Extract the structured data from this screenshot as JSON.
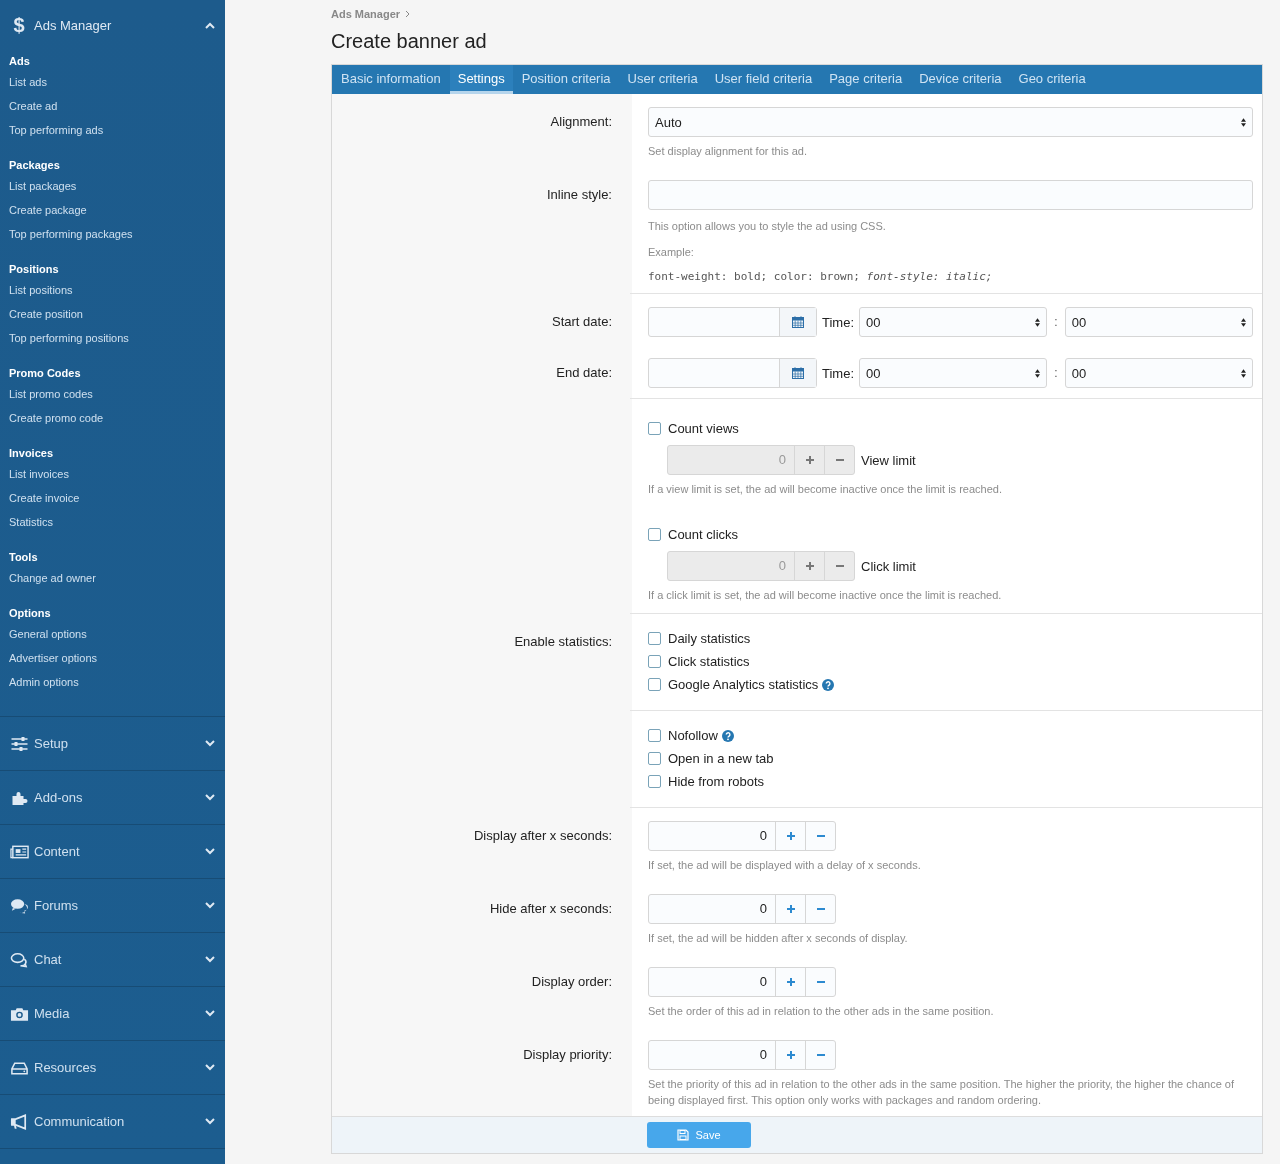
{
  "sidebar": {
    "header": {
      "symbol": "$",
      "title": "Ads Manager",
      "expanded": true
    },
    "groups": [
      {
        "title": "Ads",
        "links": [
          "List ads",
          "Create ad",
          "Top performing ads"
        ]
      },
      {
        "title": "Packages",
        "links": [
          "List packages",
          "Create package",
          "Top performing packages"
        ]
      },
      {
        "title": "Positions",
        "links": [
          "List positions",
          "Create position",
          "Top performing positions"
        ]
      },
      {
        "title": "Promo Codes",
        "links": [
          "List promo codes",
          "Create promo code"
        ]
      },
      {
        "title": "Invoices",
        "links": [
          "List invoices",
          "Create invoice",
          "Statistics"
        ]
      },
      {
        "title": "Tools",
        "links": [
          "Change ad owner"
        ]
      },
      {
        "title": "Options",
        "links": [
          "General options",
          "Advertiser options",
          "Admin options"
        ]
      }
    ],
    "sections": [
      {
        "label": "Setup",
        "kind": "sliders",
        "expanded": false
      },
      {
        "label": "Add-ons",
        "kind": "puzzle",
        "expanded": false
      },
      {
        "label": "Content",
        "kind": "newspaper",
        "expanded": false
      },
      {
        "label": "Forums",
        "kind": "comments",
        "expanded": false
      },
      {
        "label": "Chat",
        "kind": "chat",
        "expanded": false
      },
      {
        "label": "Media",
        "kind": "camera",
        "expanded": false
      },
      {
        "label": "Resources",
        "kind": "drive",
        "expanded": false
      },
      {
        "label": "Communication",
        "kind": "bullhorn",
        "expanded": false
      }
    ]
  },
  "breadcrumb": [
    "Ads Manager"
  ],
  "title": "Create banner ad",
  "tabs": [
    {
      "label": "Basic information",
      "selected": false
    },
    {
      "label": "Settings",
      "selected": true
    },
    {
      "label": "Position criteria",
      "selected": false
    },
    {
      "label": "User criteria",
      "selected": false
    },
    {
      "label": "User field criteria",
      "selected": false
    },
    {
      "label": "Page criteria",
      "selected": false
    },
    {
      "label": "Device criteria",
      "selected": false
    },
    {
      "label": "Geo criteria",
      "selected": false
    }
  ],
  "rows": [
    {
      "kind": "select",
      "label": "Alignment:",
      "value": "Auto",
      "hints": [
        "Set display alignment for this ad."
      ],
      "divider": false
    },
    {
      "kind": "text",
      "label": "Inline style:",
      "hints": [
        "This option allows you to style the ad using CSS.",
        "Example:"
      ],
      "code": "font-weight: bold; color: brown; *font-style: italic;*",
      "divider": true
    },
    {
      "kind": "datetime",
      "label": "Start date:",
      "time_label": "Time:",
      "hour": "00",
      "separator": ":",
      "minute": "00",
      "divider": false
    },
    {
      "kind": "datetime",
      "label": "End date:",
      "time_label": "Time:",
      "hour": "00",
      "separator": ":",
      "minute": "00",
      "divider": true
    },
    {
      "kind": "limits",
      "items": [
        {
          "label": "Count views",
          "checked": false,
          "help": false,
          "disabled": true,
          "value": "0",
          "unit": "View limit",
          "hint": "If a view limit is set, the ad will become inactive once the limit is reached."
        },
        {
          "label": "Count clicks",
          "checked": false,
          "help": false,
          "disabled": true,
          "value": "0",
          "unit": "Click limit",
          "hint": "If a click limit is set, the ad will become inactive once the limit is reached."
        }
      ],
      "divider": true
    },
    {
      "kind": "checklist",
      "label": "Enable statistics:",
      "options": [
        {
          "label": "Daily statistics",
          "checked": false,
          "help": false
        },
        {
          "label": "Click statistics",
          "checked": false,
          "help": false
        },
        {
          "label": "Google Analytics statistics",
          "checked": false,
          "help": true
        }
      ],
      "divider": true
    },
    {
      "kind": "checklist",
      "options": [
        {
          "label": "Nofollow",
          "checked": false,
          "help": true
        },
        {
          "label": "Open in a new tab",
          "checked": false,
          "help": false
        },
        {
          "label": "Hide from robots",
          "checked": false,
          "help": false
        }
      ],
      "divider": true
    },
    {
      "kind": "number",
      "label": "Display after x seconds:",
      "value": "0",
      "hints": [
        "If set, the ad will be displayed with a delay of x seconds."
      ],
      "divider": false
    },
    {
      "kind": "number",
      "label": "Hide after x seconds:",
      "value": "0",
      "hints": [
        "If set, the ad will be hidden after x seconds of display."
      ],
      "divider": false
    },
    {
      "kind": "number",
      "label": "Display order:",
      "value": "0",
      "hints": [
        "Set the order of this ad in relation to the other ads in the same position."
      ],
      "divider": false
    },
    {
      "kind": "number",
      "label": "Display priority:",
      "value": "0",
      "hints": [
        "Set the priority of this ad in relation to the other ads in the same position. The higher the priority, the higher the chance of being displayed first. This option only works with packages and random ordering."
      ],
      "divider": false
    }
  ],
  "save_button": "Save"
}
